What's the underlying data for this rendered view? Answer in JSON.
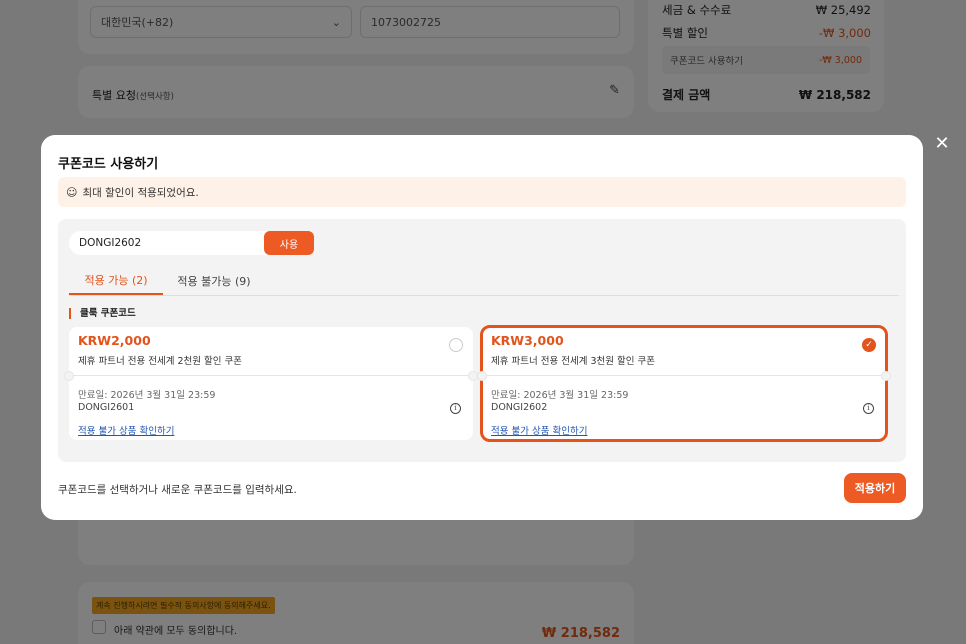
{
  "background": {
    "country_select": "대한민국(+82)",
    "phone_value": "1073002725",
    "special_request_label": "특별 요청",
    "special_request_optional": "(선택사항)",
    "tax_label": "세금 & 수수료",
    "tax_value": "₩ 25,492",
    "discount_label": "특별 할인",
    "discount_value": "-₩ 3,000",
    "coupon_use_label": "쿠폰코드 사용하기",
    "coupon_use_value": "-₩ 3,000",
    "total_label": "결제 금액",
    "total_value": "₩ 218,582",
    "agree_notice": "계속 진행하시려면 필수적 동의사항에 동의해주세요.",
    "agree_all": "아래 약관에 모두 동의합니다.",
    "bottom_total": "₩ 218,582"
  },
  "modal": {
    "title": "쿠폰코드 사용하기",
    "notice": "최대 할인이 적용되었어요.",
    "code_input_value": "DONGI2602",
    "use_button": "사용",
    "tabs": [
      {
        "label": "적용 가능 (2)",
        "active": true
      },
      {
        "label": "적용 불가능 (9)",
        "active": false
      }
    ],
    "section_title": "클룩 쿠폰코드",
    "coupons": [
      {
        "amount": "KRW2,000",
        "description": "제휴 파트너 전용 전세계 2천원 할인 쿠폰",
        "expiry": "만료일: 2026년 3월 31일 23:59",
        "code": "DONGI2601",
        "link": "적용 불가 상품 확인하기",
        "selected": false
      },
      {
        "amount": "KRW3,000",
        "description": "제휴 파트너 전용 전세계 3천원 할인 쿠폰",
        "expiry": "만료일: 2026년 3월 31일 23:59",
        "code": "DONGI2602",
        "link": "적용 불가 상품 확인하기",
        "selected": true
      }
    ],
    "footer_text": "쿠폰코드를 선택하거나 새로운 쿠폰코드를 입력하세요.",
    "apply_button": "적용하기"
  },
  "icons": {
    "close": "close-icon",
    "chevron": "chevron-down-icon",
    "edit": "edit-icon",
    "smile": "smile-icon",
    "check": "check-icon",
    "info": "info-icon"
  },
  "colors": {
    "accent": "#ee5a24",
    "notice_bg": "#fdf1e8",
    "link": "#2256b2"
  }
}
